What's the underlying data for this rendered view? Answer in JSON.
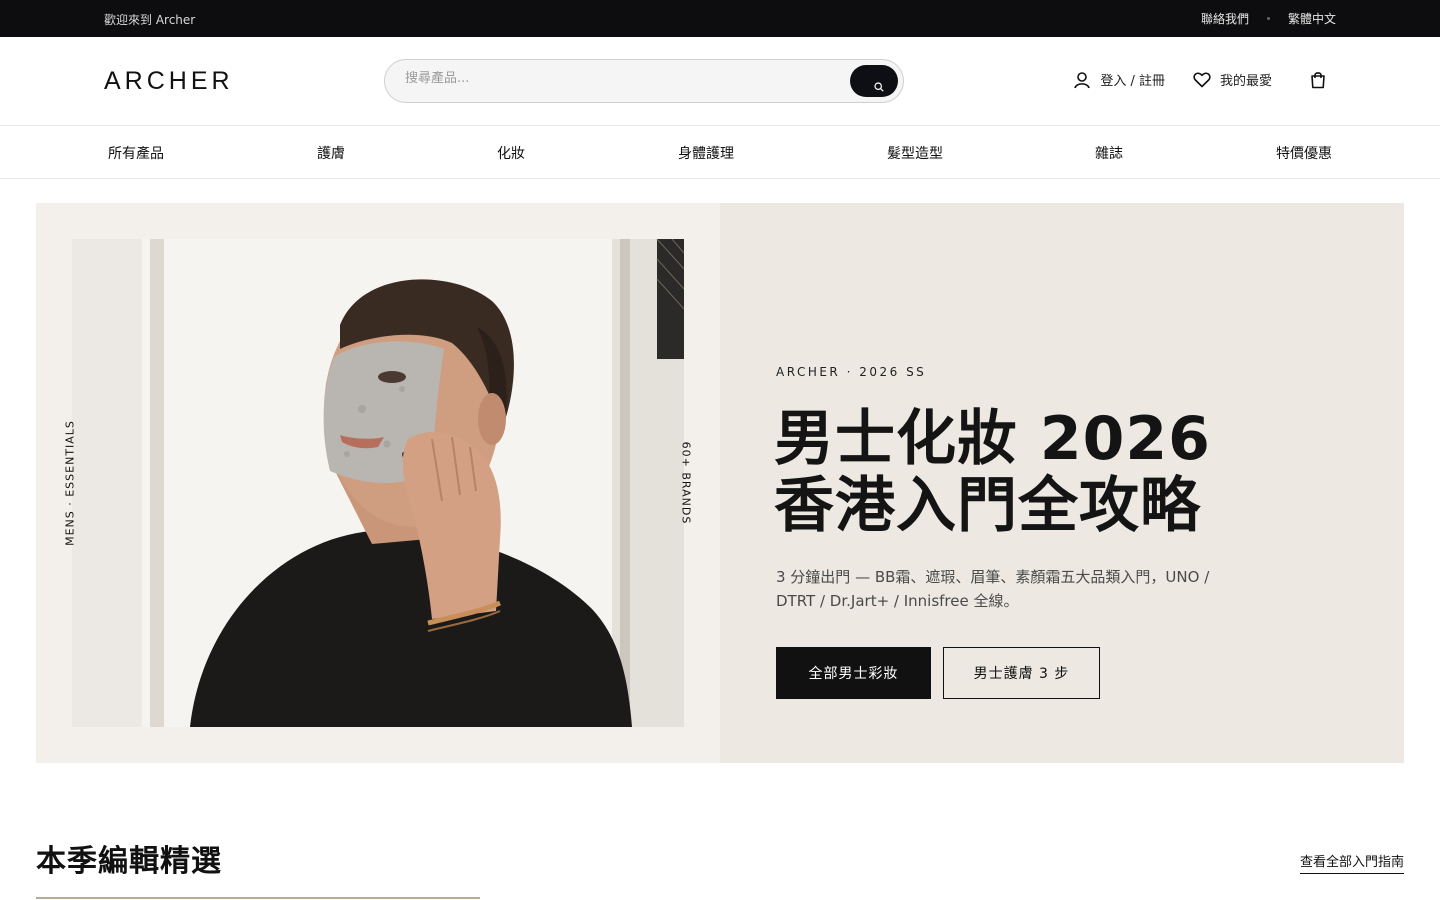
{
  "topbar": {
    "welcome": "歡迎來到 Archer",
    "contact": "聯絡我們",
    "language": "繁體中文"
  },
  "header": {
    "logo": "ARCHER",
    "search_placeholder": "搜尋產品...",
    "login_label": "登入 / 註冊",
    "wishlist_label": "我的最愛"
  },
  "nav": {
    "items": [
      {
        "label": "所有產品"
      },
      {
        "label": "護膚"
      },
      {
        "label": "化妝"
      },
      {
        "label": "身體護理"
      },
      {
        "label": "髮型造型"
      },
      {
        "label": "雜誌"
      },
      {
        "label": "特價優惠"
      }
    ]
  },
  "hero": {
    "side_label_left": "MENS · ESSENTIALS",
    "side_label_right": "60+ BRANDS",
    "eyebrow": "ARCHER · 2026 SS",
    "headline_line1": "男士化妝 2026",
    "headline_line2": "香港入門全攻略",
    "description": "3 分鐘出門 — BB霜、遮瑕、眉筆、素顏霜五大品類入門，UNO / DTRT / Dr.Jart+ / Innisfree 全線。",
    "primary_cta": "全部男士彩妝",
    "secondary_cta": "男士護膚 3 步"
  },
  "section": {
    "title": "本季編輯精選",
    "see_all": "查看全部入門指南"
  },
  "colors": {
    "topbar_bg": "#0d0d0f",
    "hero_left_bg": "#f3f0eb",
    "hero_right_bg": "#ede9e2",
    "accent_dark": "#111111"
  }
}
